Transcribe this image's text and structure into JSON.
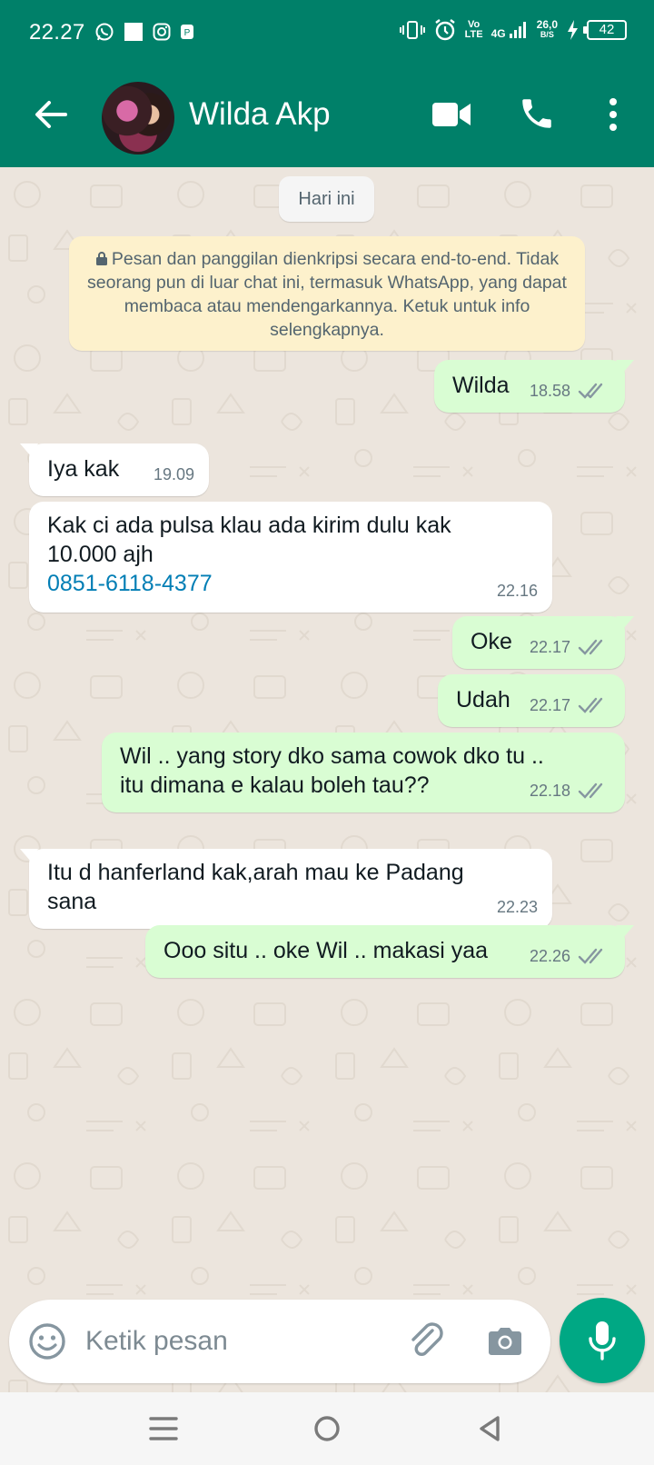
{
  "status_bar": {
    "time": "22.27",
    "network_type": "4G",
    "volte_label_top": "Vo",
    "volte_label_bottom": "LTE",
    "speed_value": "26,0",
    "speed_unit": "B/S",
    "battery": "42"
  },
  "header": {
    "contact_name": "Wilda Akp"
  },
  "chat": {
    "date_chip": "Hari ini",
    "e2e_notice": "Pesan dan panggilan dienkripsi secara end-to-end. Tidak seorang pun di luar chat ini, termasuk WhatsApp, yang dapat membaca atau mendengarkannya. Ketuk untuk info selengkapnya.",
    "messages": [
      {
        "direction": "out",
        "text": "Wilda",
        "time": "18.58",
        "status": "read"
      },
      {
        "direction": "in",
        "text": "Iya kak",
        "time": "19.09"
      },
      {
        "direction": "in",
        "text": "Kak ci ada pulsa klau ada kirim dulu kak 10.000 ajh",
        "link": "0851-6118-4377",
        "time": "22.16"
      },
      {
        "direction": "out",
        "text": "Oke",
        "time": "22.17",
        "status": "read"
      },
      {
        "direction": "out",
        "text": "Udah",
        "time": "22.17",
        "status": "read"
      },
      {
        "direction": "out",
        "text": "Wil .. yang story dko sama cowok dko tu .. itu dimana e kalau boleh tau??",
        "time": "22.18",
        "status": "read"
      },
      {
        "direction": "in",
        "text": "Itu d hanferland kak,arah mau ke Padang sana",
        "time": "22.23"
      },
      {
        "direction": "out",
        "text": "Ooo situ .. oke Wil .. makasi yaa",
        "time": "22.26",
        "status": "read"
      }
    ]
  },
  "composer": {
    "placeholder": "Ketik pesan"
  },
  "colors": {
    "header": "#008069",
    "chat_background": "#ece5dd",
    "outgoing_bubble": "#d9fdd3",
    "incoming_bubble": "#ffffff",
    "notice_background": "#fdf1cc",
    "mic_button": "#00a884",
    "link": "#027eb5"
  },
  "icons": {
    "back": "arrow-left-icon",
    "video": "video-camera-icon",
    "call": "phone-icon",
    "menu": "more-vertical-icon",
    "emoji": "emoji-icon",
    "attach": "paperclip-icon",
    "camera": "camera-icon",
    "mic": "microphone-icon",
    "lock": "lock-icon",
    "read": "double-check-icon"
  }
}
